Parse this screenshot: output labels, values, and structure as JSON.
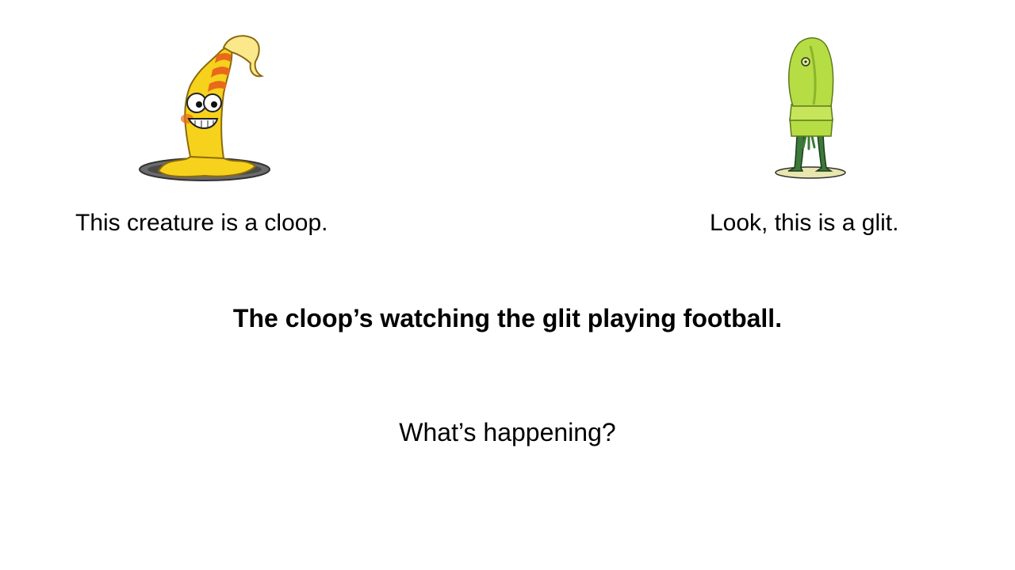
{
  "slide": {
    "left_creature": {
      "icon": "cloop-creature-illustration",
      "caption": "This creature is a cloop."
    },
    "right_creature": {
      "icon": "glit-creature-illustration",
      "caption": "Look, this is a glit."
    },
    "sentence": "The cloop’s watching the glit playing football.",
    "question": "What’s happening?"
  },
  "colors": {
    "background": "#ffffff",
    "text": "#000000",
    "cloop_body": "#f7d21c",
    "cloop_stripe": "#e8691a",
    "glit_body": "#b7dd45",
    "glit_legs": "#3d7a3a"
  }
}
